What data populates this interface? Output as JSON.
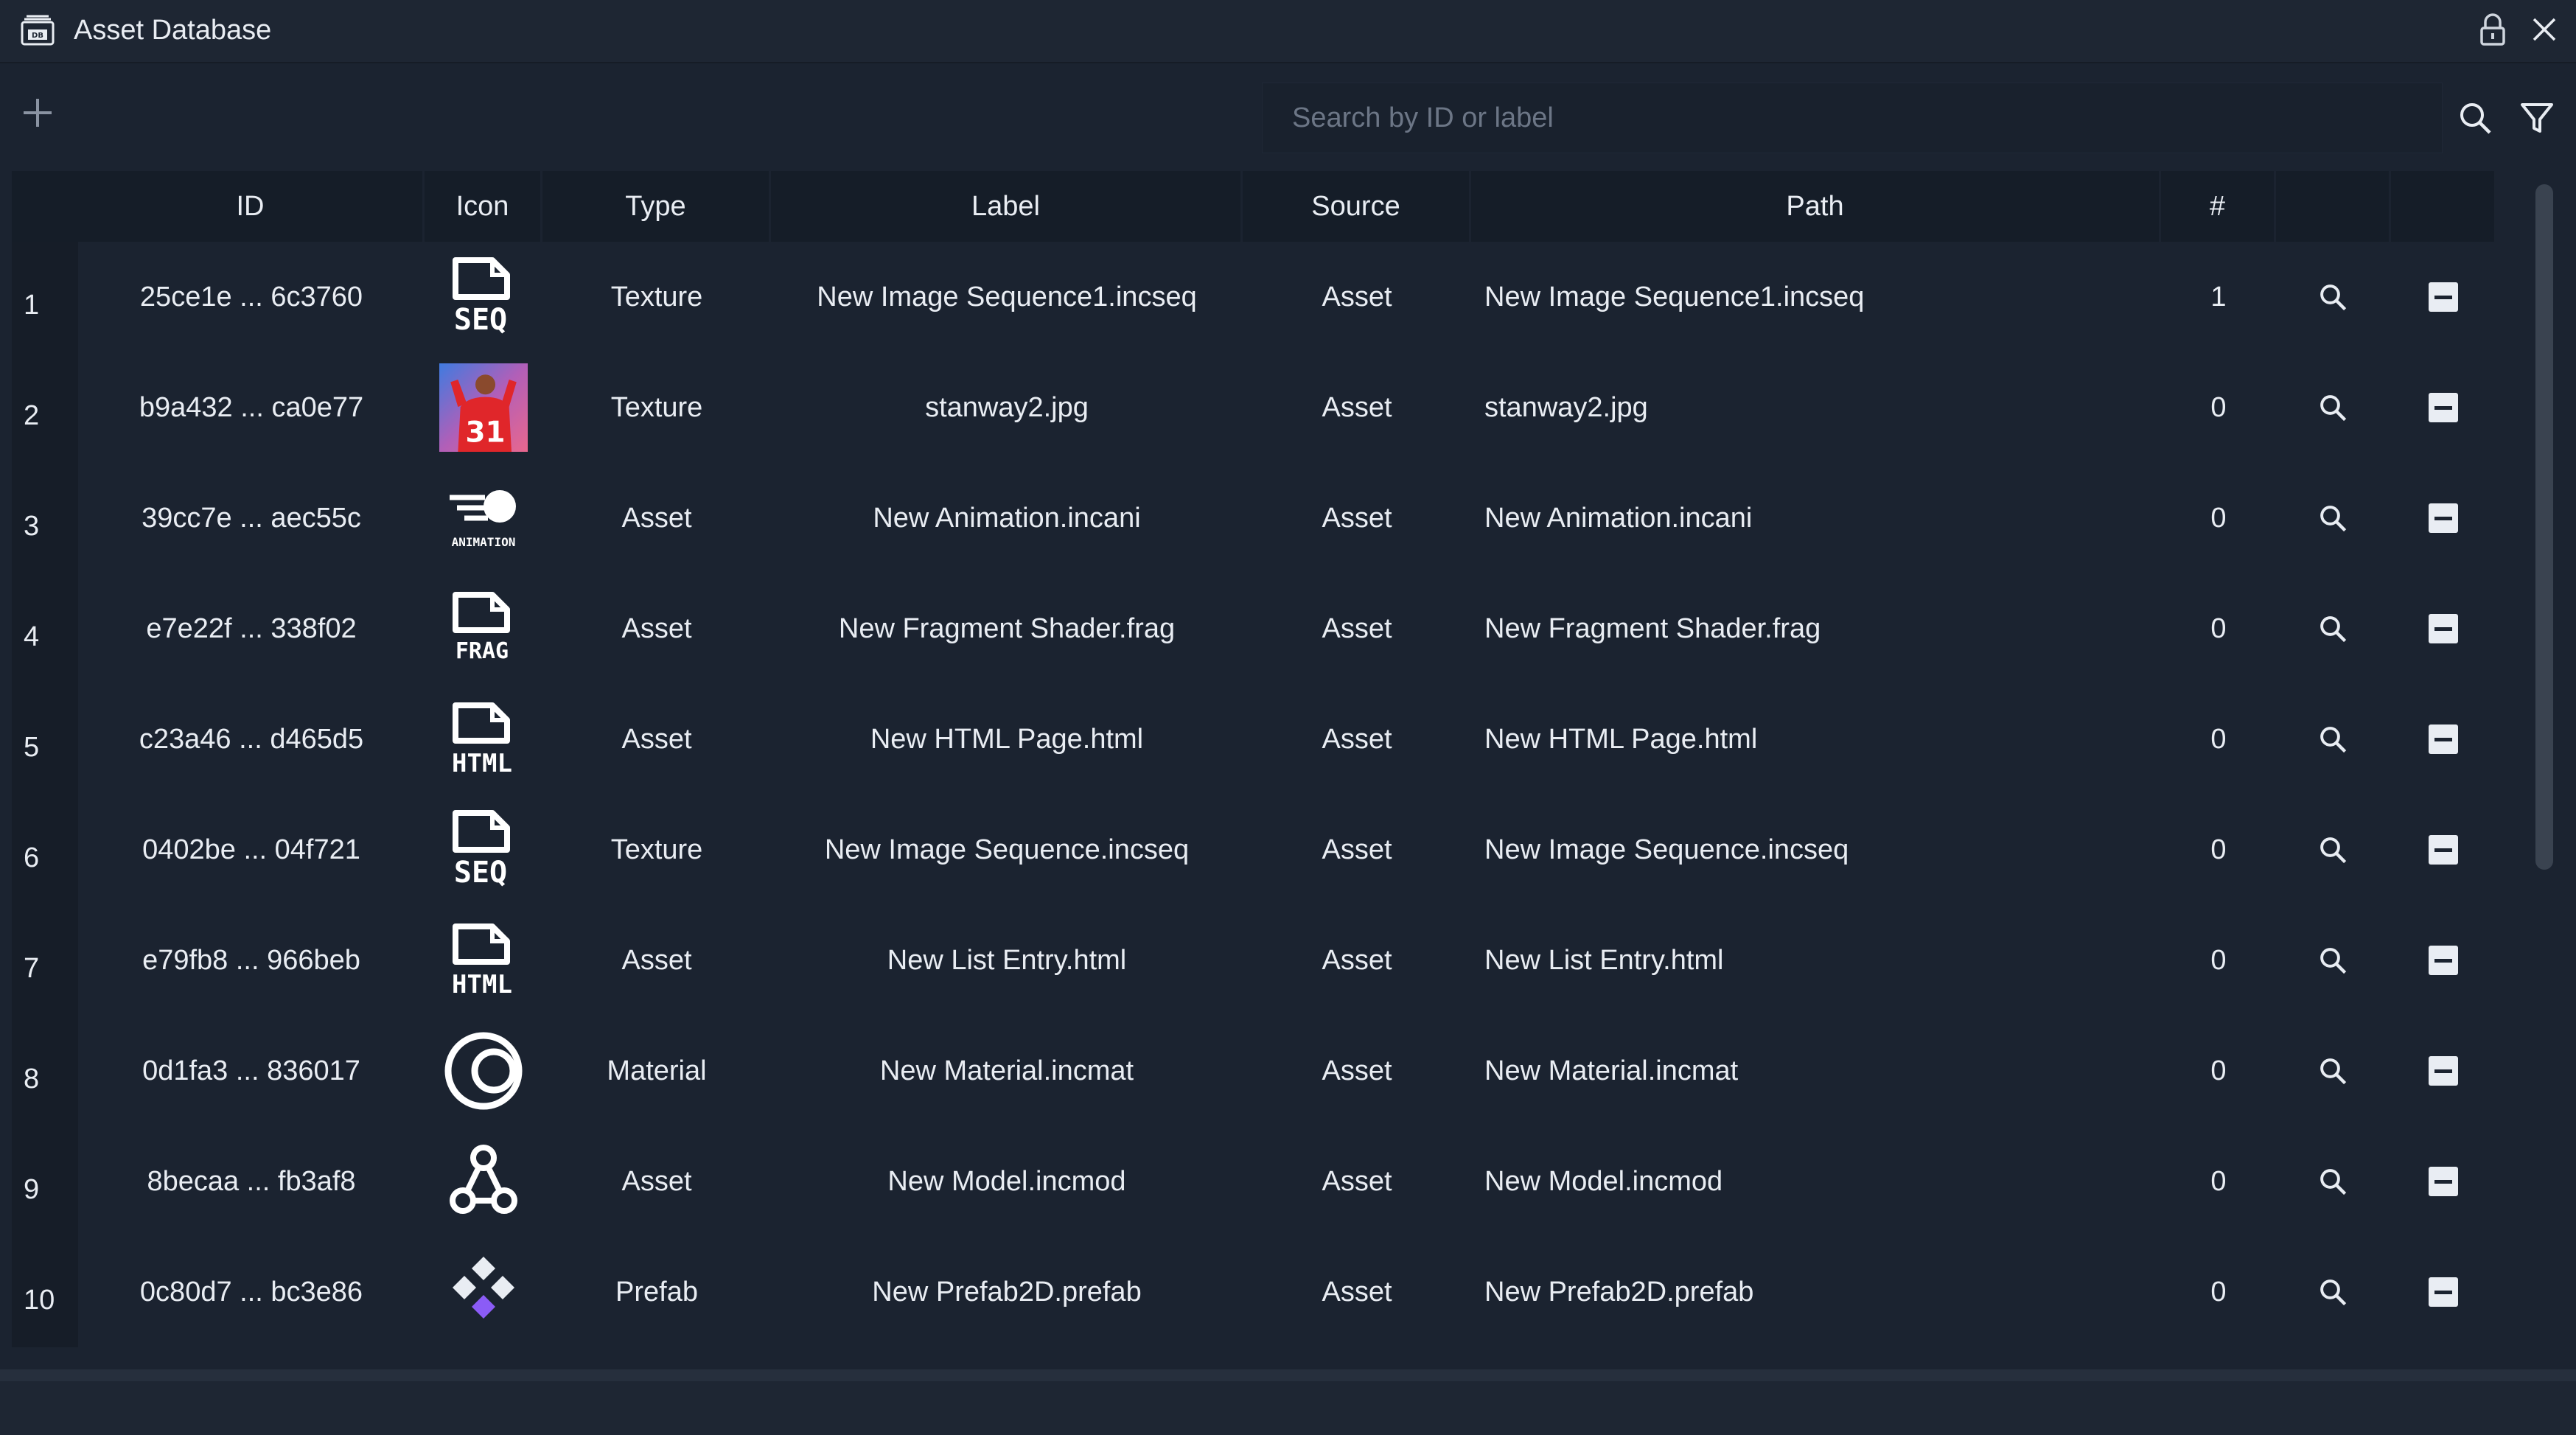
{
  "window": {
    "title": "Asset Database",
    "title_icon": "database-icon",
    "lock_icon": "lock-icon",
    "close_icon": "close-icon"
  },
  "toolbar": {
    "add_icon": "plus-icon",
    "search_placeholder": "Search by ID or label",
    "search_value": "",
    "search_icon": "search-icon",
    "filter_icon": "filter-icon"
  },
  "table": {
    "columns": [
      "ID",
      "Icon",
      "Type",
      "Label",
      "Source",
      "Path",
      "#",
      "",
      ""
    ],
    "rows": [
      {
        "num": "1",
        "id": "25ce1e ... 6c3760",
        "icon": "seq-file-icon",
        "type": "Texture",
        "label": "New Image Sequence1.incseq",
        "source": "Asset",
        "path": "New Image Sequence1.incseq",
        "count": "1"
      },
      {
        "num": "2",
        "id": "b9a432 ... ca0e77",
        "icon": "image-thumbnail",
        "type": "Texture",
        "label": "stanway2.jpg",
        "source": "Asset",
        "path": "stanway2.jpg",
        "count": "0"
      },
      {
        "num": "3",
        "id": "39cc7e ... aec55c",
        "icon": "animation-icon",
        "type": "Asset",
        "label": "New Animation.incani",
        "source": "Asset",
        "path": "New Animation.incani",
        "count": "0"
      },
      {
        "num": "4",
        "id": "e7e22f ... 338f02",
        "icon": "frag-file-icon",
        "type": "Asset",
        "label": "New Fragment Shader.frag",
        "source": "Asset",
        "path": "New Fragment Shader.frag",
        "count": "0"
      },
      {
        "num": "5",
        "id": "c23a46 ... d465d5",
        "icon": "html-file-icon",
        "type": "Asset",
        "label": "New HTML Page.html",
        "source": "Asset",
        "path": "New HTML Page.html",
        "count": "0"
      },
      {
        "num": "6",
        "id": "0402be ... 04f721",
        "icon": "seq-file-icon",
        "type": "Texture",
        "label": "New Image Sequence.incseq",
        "source": "Asset",
        "path": "New Image Sequence.incseq",
        "count": "0"
      },
      {
        "num": "7",
        "id": "e79fb8 ... 966beb",
        "icon": "html-file-icon",
        "type": "Asset",
        "label": "New List Entry.html",
        "source": "Asset",
        "path": "New List Entry.html",
        "count": "0"
      },
      {
        "num": "8",
        "id": "0d1fa3 ... 836017",
        "icon": "material-icon",
        "type": "Material",
        "label": "New Material.incmat",
        "source": "Asset",
        "path": "New Material.incmat",
        "count": "0"
      },
      {
        "num": "9",
        "id": "8becaa ... fb3af8",
        "icon": "model-icon",
        "type": "Asset",
        "label": "New Model.incmod",
        "source": "Asset",
        "path": "New Model.incmod",
        "count": "0"
      },
      {
        "num": "10",
        "id": "0c80d7 ... bc3e86",
        "icon": "prefab-icon",
        "type": "Prefab",
        "label": "New Prefab2D.prefab",
        "source": "Asset",
        "path": "New Prefab2D.prefab",
        "count": "0"
      }
    ],
    "row_action_icons": [
      "search-icon",
      "remove-icon"
    ]
  },
  "icon_labels": {
    "seq": "SEQ",
    "frag": "FRAG",
    "html": "HTML",
    "animation": "ANIMATION",
    "thumbnail_number": "31"
  },
  "colors": {
    "background": "#1b2330",
    "header": "#151d28",
    "text": "#e9edf3",
    "placeholder": "#6c7686",
    "prefab_accent": "#8b5cf6"
  }
}
